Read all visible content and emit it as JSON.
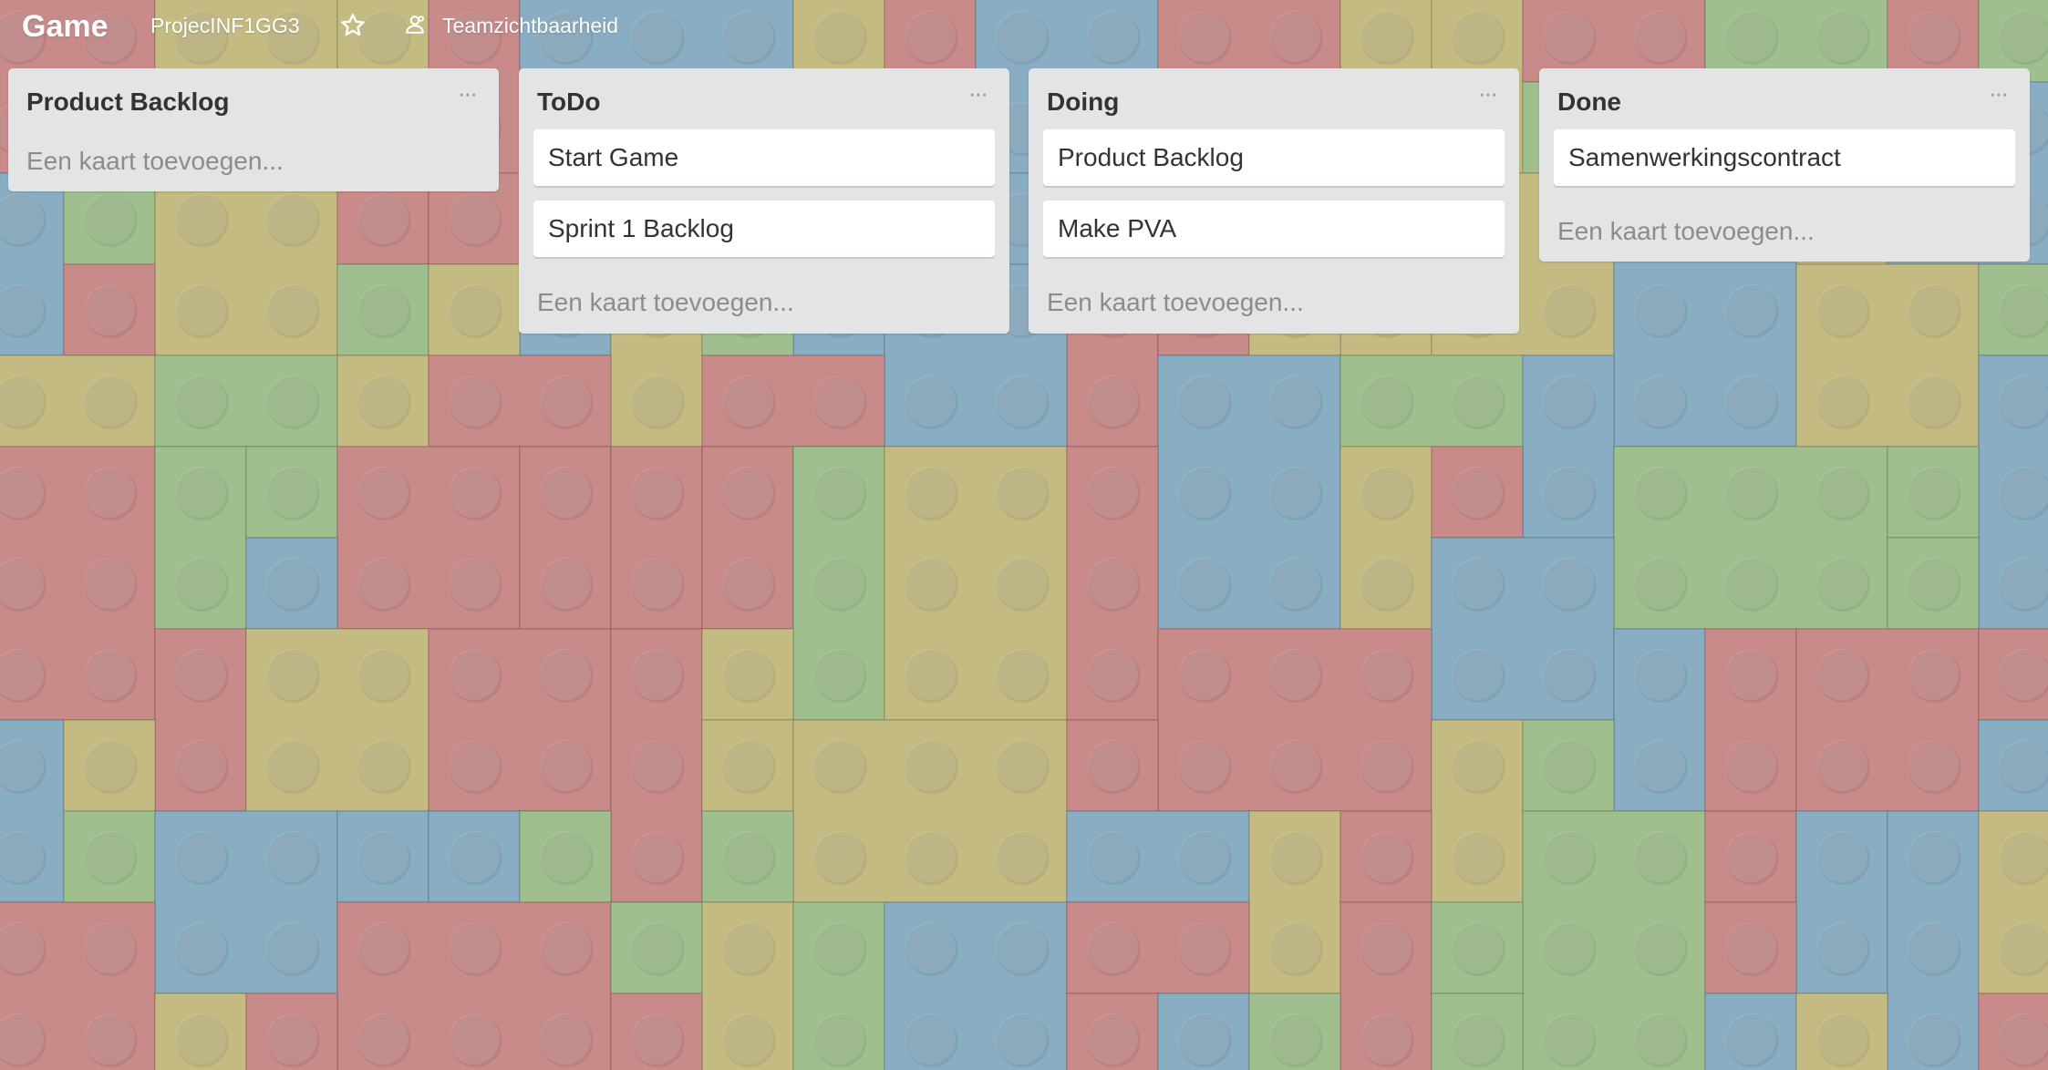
{
  "header": {
    "board_title": "Game",
    "team_name": "ProjecINF1GG3",
    "visibility_label": "Teamzichtbaarheid"
  },
  "lists": [
    {
      "title": "Product Backlog",
      "cards": [],
      "add_card_label": "Een kaart toevoegen..."
    },
    {
      "title": "ToDo",
      "cards": [
        "Start Game",
        "Sprint 1 Backlog"
      ],
      "add_card_label": "Een kaart toevoegen..."
    },
    {
      "title": "Doing",
      "cards": [
        "Product Backlog",
        "Make PVA"
      ],
      "add_card_label": "Een kaart toevoegen..."
    },
    {
      "title": "Done",
      "cards": [
        "Samenwerkingscontract"
      ],
      "add_card_label": "Een kaart toevoegen..."
    }
  ],
  "icons": {
    "star": "star-icon",
    "visibility": "team-visibility-icon",
    "list_menu": "ellipsis-icon"
  },
  "colors": {
    "lego_red": "#c98a8a",
    "lego_blue": "#89aec3",
    "lego_green": "#9fc08e",
    "lego_yellow": "#c4bb82",
    "list_bg": "#e2e4e6"
  }
}
